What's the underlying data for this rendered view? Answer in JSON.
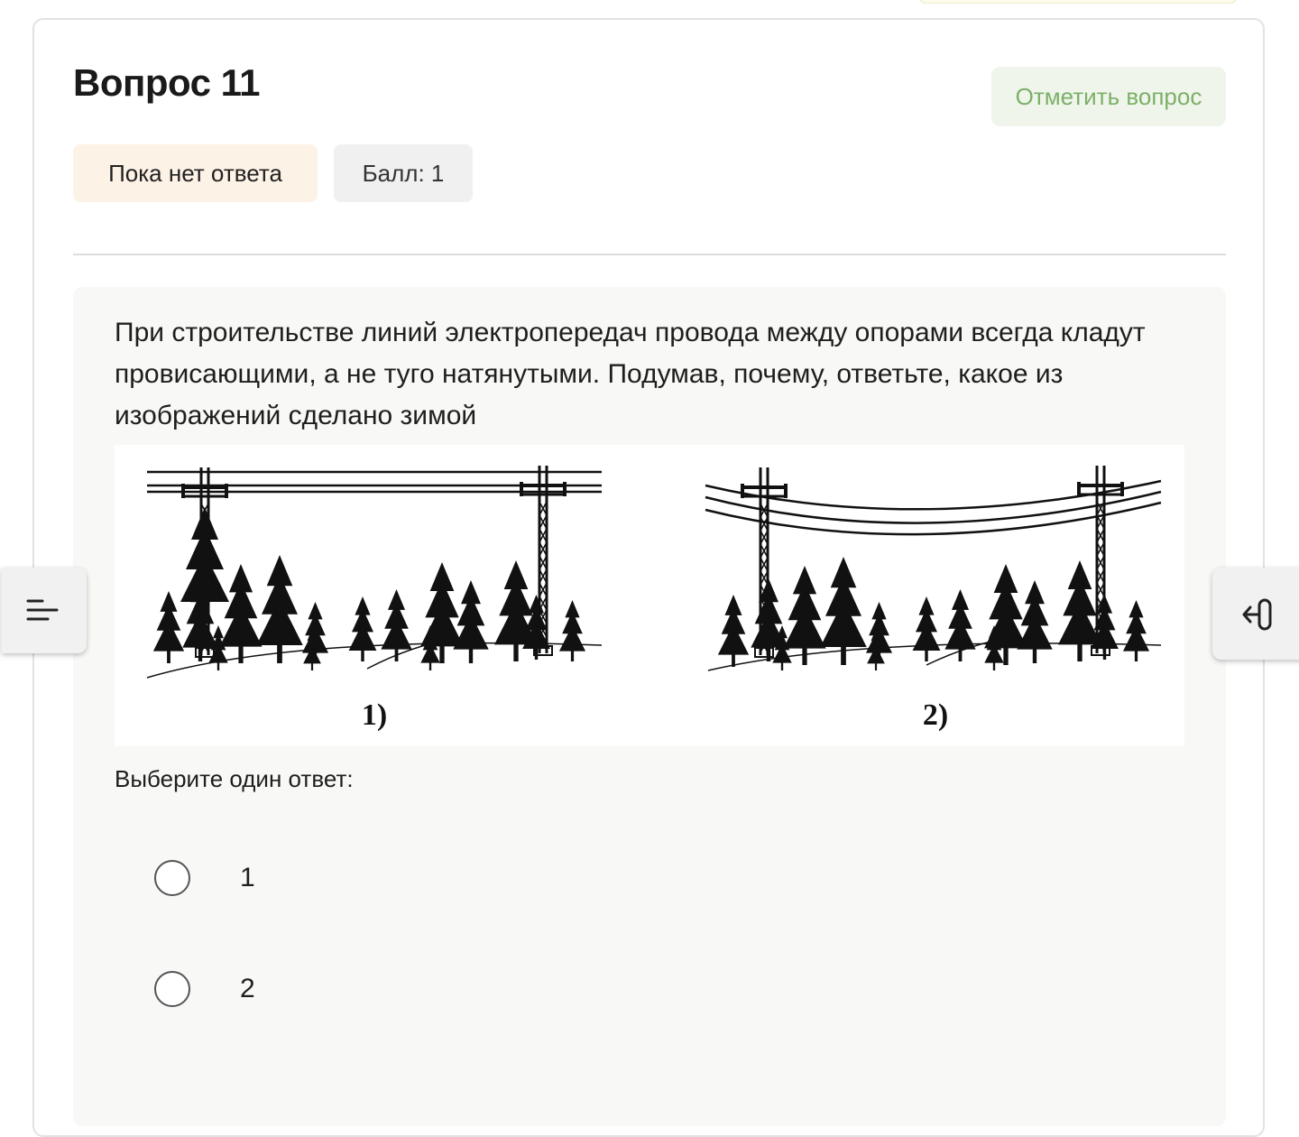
{
  "question": {
    "title": "Вопрос 11",
    "flag_button_label": "Отметить вопрос",
    "status_badge": "Пока нет ответа",
    "score_badge": "Балл: 1",
    "text": "При строительстве линий электропередач провода между опорами всегда кладут провисающими, а не туго натянутыми. Подумав, почему, ответьте, какое из изображений сделано зимой",
    "figure_captions": [
      "1)",
      "2)"
    ],
    "answer_prompt": "Выберите один ответ:",
    "options": [
      {
        "label": "1",
        "selected": false
      },
      {
        "label": "2",
        "selected": false
      }
    ]
  },
  "colors": {
    "flag_button_bg": "#eff5ea",
    "flag_button_text": "#7cb069",
    "status_badge_bg": "#fdf2e6",
    "score_badge_bg": "#f0f0f0",
    "content_bg": "#f8f9f6"
  },
  "icons": {
    "left_drawer": "course-index-icon",
    "right_drawer": "block-drawer-icon"
  }
}
